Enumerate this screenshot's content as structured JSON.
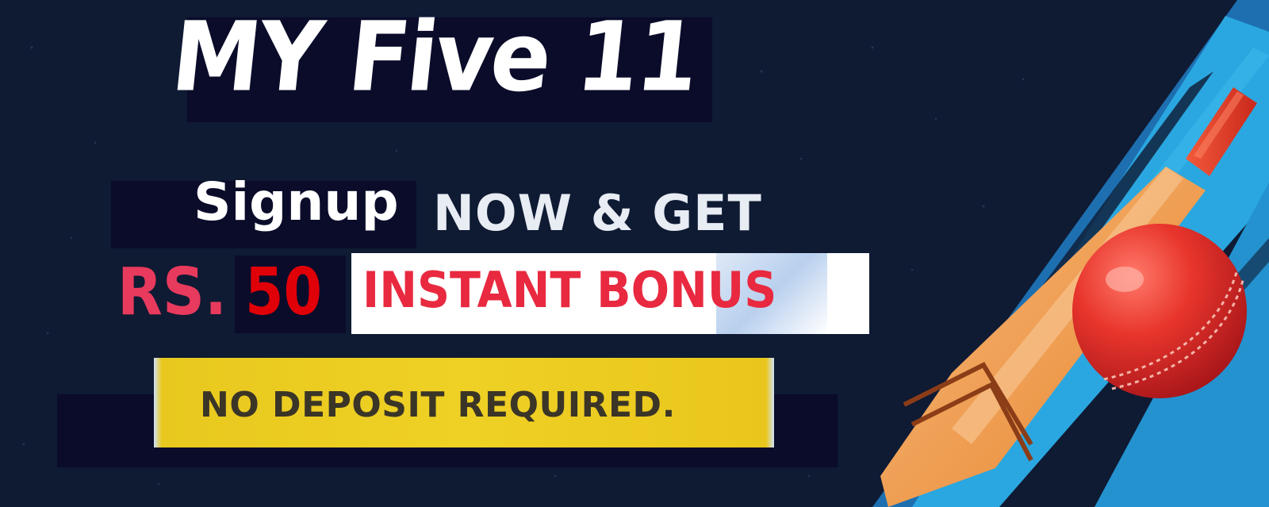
{
  "banner": {
    "title": "MY Five 11",
    "signup": "Signup",
    "now_get": "NOW & GET",
    "currency": "RS.",
    "amount": "50",
    "bonus": "INSTANT BONUS",
    "no_deposit": "NO DEPOSIT REQUIRED."
  },
  "colors": {
    "background": "#0f1a33",
    "title_box": "#0a0c2a",
    "rs_pink": "#e83a5d",
    "amount_red": "#e00008",
    "bonus_red": "#e8293f",
    "ribbon_yellow": "#efd024",
    "stripe_blue": "#2aa7e0",
    "bat_orange": "#f0a15c",
    "ball_red": "#e8352c"
  },
  "icons": {
    "bat": "cricket-bat-icon",
    "ball": "cricket-ball-icon"
  }
}
